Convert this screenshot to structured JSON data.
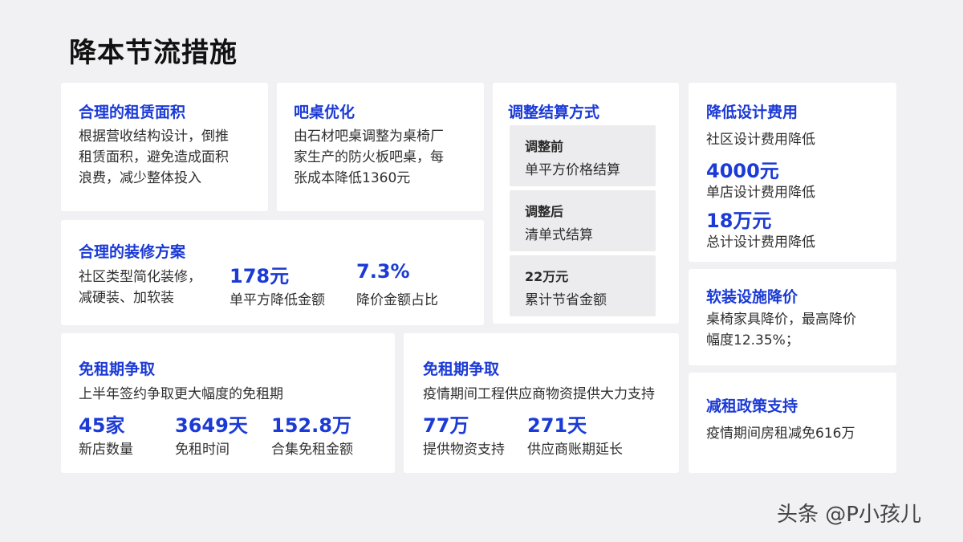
{
  "page": {
    "title": "降本节流措施"
  },
  "cards": {
    "rent_area": {
      "title": "合理的租赁面积",
      "lines": [
        "根据营收结构设计，倒推",
        "租赁面积，避免造成面积",
        "浪费，减少整体投入"
      ]
    },
    "bar_table": {
      "title": "吧桌优化",
      "lines": [
        "由石材吧桌调整为桌椅厂",
        "家生产的防火板吧桌，每",
        "张成本降低1360元"
      ]
    },
    "settlement": {
      "title": "调整结算方式",
      "items": [
        {
          "head": "调整前",
          "desc": "单平方价格结算"
        },
        {
          "head": "调整后",
          "desc": "清单式结算"
        },
        {
          "head": "22万元",
          "desc": "累计节省金额"
        }
      ]
    },
    "design_cost": {
      "title": "降低设计费用",
      "intro": "社区设计费用降低",
      "stats": [
        {
          "value": "4000元",
          "label": "单店设计费用降低"
        },
        {
          "value": "18万元",
          "label": "总计设计费用降低"
        }
      ]
    },
    "decoration": {
      "title": "合理的装修方案",
      "lines": [
        "社区类型简化装修，",
        "减硬装、加软装"
      ],
      "stats": [
        {
          "value": "178元",
          "label": "单平方降低金额"
        },
        {
          "value": "7.3%",
          "label": "降价金额占比"
        }
      ]
    },
    "soft_furnish": {
      "title": "软装设施降价",
      "lines": [
        "桌椅家具降价，最高降价",
        "幅度12.35%；"
      ]
    },
    "rent_free_1": {
      "title": "免租期争取",
      "intro": "上半年签约争取更大幅度的免租期",
      "stats": [
        {
          "value": "45家",
          "label": "新店数量"
        },
        {
          "value": "3649天",
          "label": "免租时间"
        },
        {
          "value": "152.8万",
          "label": "合集免租金额"
        }
      ]
    },
    "rent_free_2": {
      "title": "免租期争取",
      "intro": "疫情期间工程供应商物资提供大力支持",
      "stats": [
        {
          "value": "77万",
          "label": "提供物资支持"
        },
        {
          "value": "271天",
          "label": "供应商账期延长"
        }
      ]
    },
    "rent_policy": {
      "title": "减租政策支持",
      "lines": [
        "疫情期间房租减免616万"
      ]
    }
  },
  "watermark": "头条 @P小孩儿"
}
